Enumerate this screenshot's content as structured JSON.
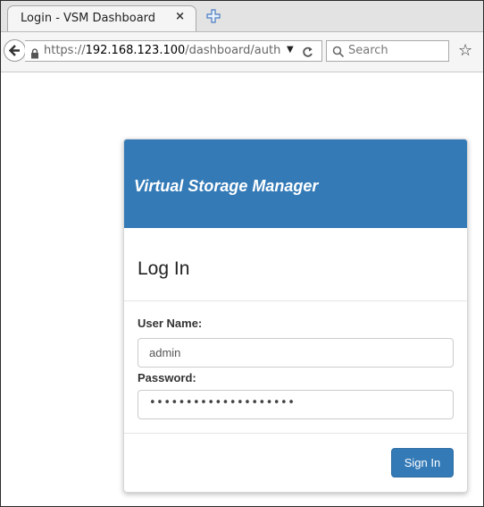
{
  "browser": {
    "tab_title": "Login - VSM Dashboard",
    "tab_close": "×",
    "url_scheme": "https://",
    "url_host": "192.168.123.100",
    "url_path": "/dashboard/auth",
    "search_placeholder": "Search"
  },
  "header": {
    "brand": "Virtual Storage Manager",
    "brand_color": "#337ab7"
  },
  "form": {
    "title": "Log In",
    "username_label": "User Name:",
    "username_value": "admin",
    "password_label": "Password:",
    "password_value": "••••••••••••••••••••",
    "submit_label": "Sign In"
  }
}
